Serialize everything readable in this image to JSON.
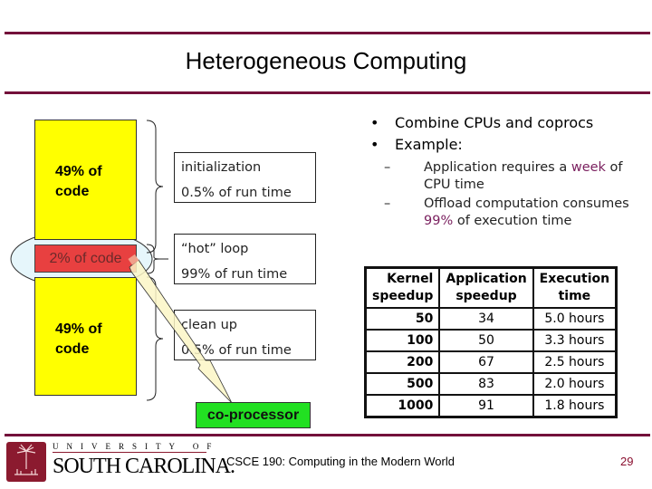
{
  "slide": {
    "title": "Heterogeneous Computing",
    "page_number": "29",
    "footer": "CSCE 190:  Computing in the Modern World",
    "logo": {
      "line1": "UNIVERSITY OF",
      "line2": "SOUTH CAROLINA."
    }
  },
  "diagram": {
    "bars": [
      {
        "label": "49% of code",
        "line1": "49% of",
        "line2": "code",
        "color": "#ffff00"
      },
      {
        "label": "2% of code",
        "color": "#e84040"
      },
      {
        "label": "49% of code",
        "line1": "49% of",
        "line2": "code",
        "color": "#ffff00"
      }
    ],
    "boxes": [
      {
        "name": "initialization",
        "runtime": "0.5% of run time"
      },
      {
        "name": "“hot” loop",
        "runtime": "99% of run time"
      },
      {
        "name": "clean up",
        "runtime": "0.5% of run time"
      }
    ],
    "coprocessor": {
      "label": "co-processor",
      "color": "#22e022"
    }
  },
  "bullets": [
    "Combine CPUs and coprocs",
    "Example:"
  ],
  "sub_bullets": [
    {
      "dash": "–",
      "before": "Application requires a ",
      "highlight": "week",
      "after": " of CPU time"
    },
    {
      "dash": "–",
      "before": "Offload computation consumes ",
      "highlight": "99%",
      "after": " of execution time"
    }
  ],
  "table": {
    "headers": [
      [
        "Kernel",
        "speedup"
      ],
      [
        "Application",
        "speedup"
      ],
      [
        "Execution",
        "time"
      ]
    ],
    "rows": [
      {
        "kernel": "50",
        "app": "34",
        "time": "5.0 hours"
      },
      {
        "kernel": "100",
        "app": "50",
        "time": "3.3 hours"
      },
      {
        "kernel": "200",
        "app": "67",
        "time": "2.5 hours"
      },
      {
        "kernel": "500",
        "app": "83",
        "time": "2.0 hours"
      },
      {
        "kernel": "1000",
        "app": "91",
        "time": "1.8 hours"
      }
    ]
  },
  "colors": {
    "accent": "#73103a",
    "highlight": "#7a1f5e"
  }
}
